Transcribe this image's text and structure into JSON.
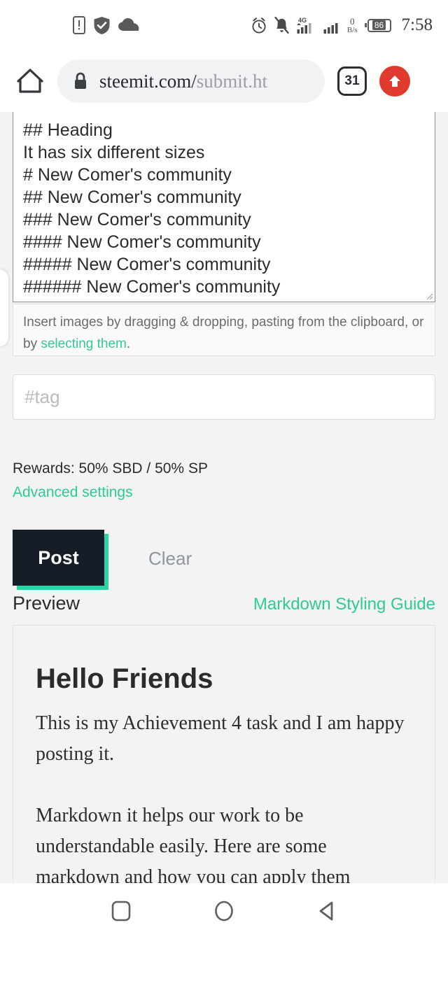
{
  "status_bar": {
    "left_icons": [
      "phone-alert-icon",
      "shield-check-icon",
      "cloud-icon"
    ],
    "alarm_icon": "alarm-clock-icon",
    "mute_icon": "bell-muted-icon",
    "network_type": "4G",
    "signal_icon_1": "signal-bars-4g-icon",
    "signal_icon_2": "signal-bars-icon",
    "data_rate_value": "0",
    "data_rate_unit": "B/s",
    "battery_level": "86",
    "time": "7:58"
  },
  "browser": {
    "home_icon": "home-icon",
    "lock_icon": "lock-icon",
    "url_host": "steemit.com/",
    "url_path": "submit.ht",
    "tab_count": "31",
    "upload_icon": "upload-arrow-icon"
  },
  "editor": {
    "content": "## Heading\nIt has six different sizes\n# New Comer's community\n## New Comer's community\n### New Comer's community\n#### New Comer's community\n##### New Comer's community\n###### New Comer's community"
  },
  "hint": {
    "text_before": "Insert images by dragging & dropping, pasting from the clipboard, or by ",
    "link_text": "selecting them",
    "text_after": "."
  },
  "tags": {
    "placeholder": "#tag",
    "value": ""
  },
  "rewards": {
    "label": "Rewards: 50% SBD / 50% SP",
    "advanced_settings": "Advanced settings"
  },
  "actions": {
    "post_label": "Post",
    "clear_label": "Clear"
  },
  "preview": {
    "label": "Preview",
    "guide_link": "Markdown Styling Guide",
    "heading": "Hello Friends",
    "paragraph_1": "This is my Achievement 4 task and I am happy posting it.",
    "paragraph_2": "Markdown it helps our work to be understandable easily. Here are some markdown and how you can apply them"
  },
  "nav_bar": {
    "recents_icon": "recents-square-icon",
    "home_icon": "home-circle-icon",
    "back_icon": "back-triangle-icon"
  },
  "colors": {
    "accent_green": "#2ecb95",
    "post_dark": "#171d26",
    "post_shadow": "#28d6a3",
    "upload_red": "#e03a2f",
    "page_bg": "#f3f3f3"
  }
}
